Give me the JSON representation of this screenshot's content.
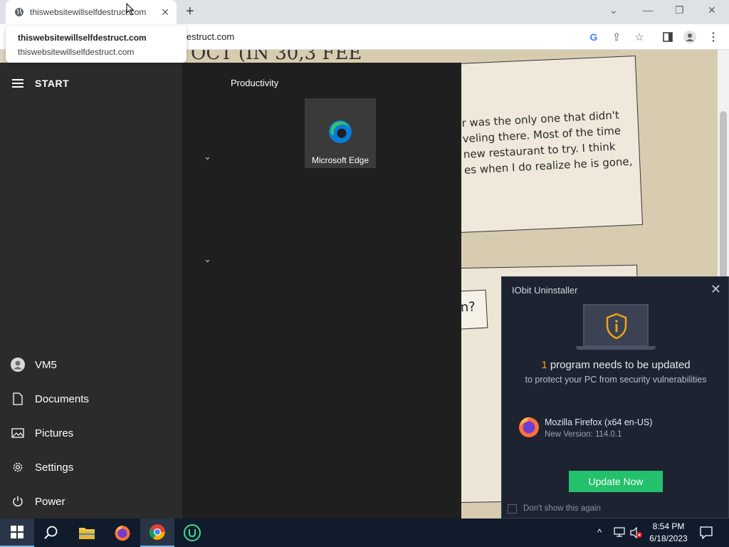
{
  "browser": {
    "tab_title": "thiswebsitewillselfdestruct.com",
    "hover_card_title": "thiswebsitewillselfdestruct.com",
    "hover_card_domain": "thiswebsitewillselfdestruct.com",
    "url_visible": "estruct.com"
  },
  "page": {
    "comic_top_text": "OCT (IN 30,3 FEE",
    "comic_lines": [
      "r was the only one that didn't",
      "veling there. Most of the time",
      "new restaurant to try. I think",
      "es when I do realize he is gone,"
    ],
    "bubble_text": "n?"
  },
  "start_menu": {
    "title": "START",
    "user": "VM5",
    "items": [
      {
        "label": "Documents",
        "icon": "document-icon"
      },
      {
        "label": "Pictures",
        "icon": "pictures-icon"
      },
      {
        "label": "Settings",
        "icon": "gear-icon"
      },
      {
        "label": "Power",
        "icon": "power-icon"
      }
    ],
    "group_title": "Productivity",
    "tile_label": "Microsoft Edge"
  },
  "iobit": {
    "title": "IObit Uninstaller",
    "count": "1",
    "headline_rest": " program needs to be updated",
    "sub": "to protect your PC from security vulnerabilities",
    "app_name": "Mozilla Firefox (x64 en-US)",
    "app_version": "New Version: 114.0.1",
    "update_button": "Update Now",
    "dont_show": "Don't show this again"
  },
  "taskbar": {
    "time": "8:54 PM",
    "date": "6/18/2023"
  },
  "colors": {
    "update_green": "#23c16b",
    "count_orange": "#f0a21a",
    "taskbar": "#101b2c"
  }
}
